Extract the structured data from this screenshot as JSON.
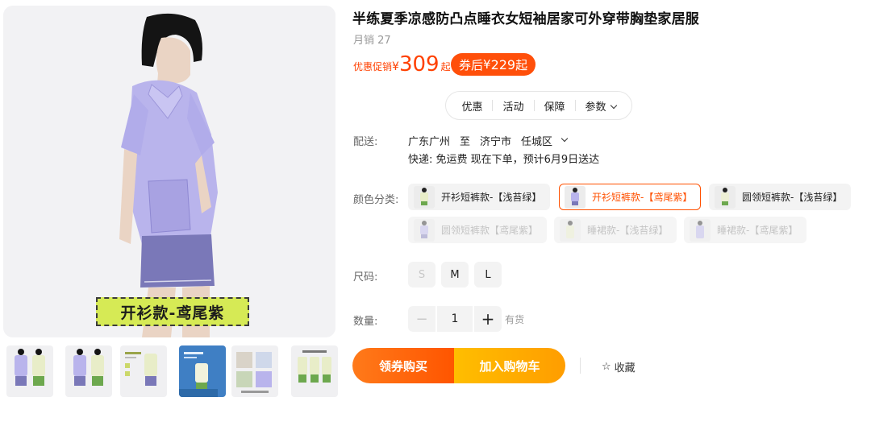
{
  "product": {
    "title": "半练夏季凉感防凸点睡衣女短袖居家可外穿带胸垫家居服",
    "monthly_sales": "月销 27",
    "image_caption": "开衫款-鸢尾紫"
  },
  "price": {
    "promo_label": "优惠促销",
    "currency": "¥",
    "amount": "309",
    "suffix": "起",
    "coupon_label": "券后",
    "coupon_price": "229",
    "coupon_suffix": "起"
  },
  "tabs": [
    "优惠",
    "活动",
    "保障",
    "参数"
  ],
  "shipping": {
    "label": "配送:",
    "from": "广东广州",
    "to_word": "至",
    "city": "济宁市",
    "district": "任城区",
    "detail": "快递: 免运费  现在下单，预计6月9日送达"
  },
  "color": {
    "label": "颜色分类:",
    "options": [
      {
        "label": "开衫短裤款-【浅苔绿】",
        "state": "normal"
      },
      {
        "label": "开衫短裤款-【鸢尾紫】",
        "state": "selected"
      },
      {
        "label": "圆领短裤款-【浅苔绿】",
        "state": "normal"
      },
      {
        "label": "圆领短裤款【鸢尾紫】",
        "state": "disabled"
      },
      {
        "label": "睡裙款-【浅苔绿】",
        "state": "disabled"
      },
      {
        "label": "睡裙款-【鸢尾紫】",
        "state": "disabled"
      }
    ]
  },
  "size": {
    "label": "尺码:",
    "options": [
      {
        "label": "S",
        "state": "disabled"
      },
      {
        "label": "M",
        "state": "normal"
      },
      {
        "label": "L",
        "state": "normal"
      }
    ]
  },
  "quantity": {
    "label": "数量:",
    "minus": "−",
    "value": "1",
    "plus": "+",
    "stock": "有货"
  },
  "actions": {
    "buy_with_coupon": "领券购买",
    "add_to_cart": "加入购物车",
    "favorite": "收藏"
  },
  "colors": {
    "accent": "#ff5000",
    "price": "#ff4000",
    "lavender": "#b9b4ec",
    "moss_green": "#d6ea55"
  }
}
